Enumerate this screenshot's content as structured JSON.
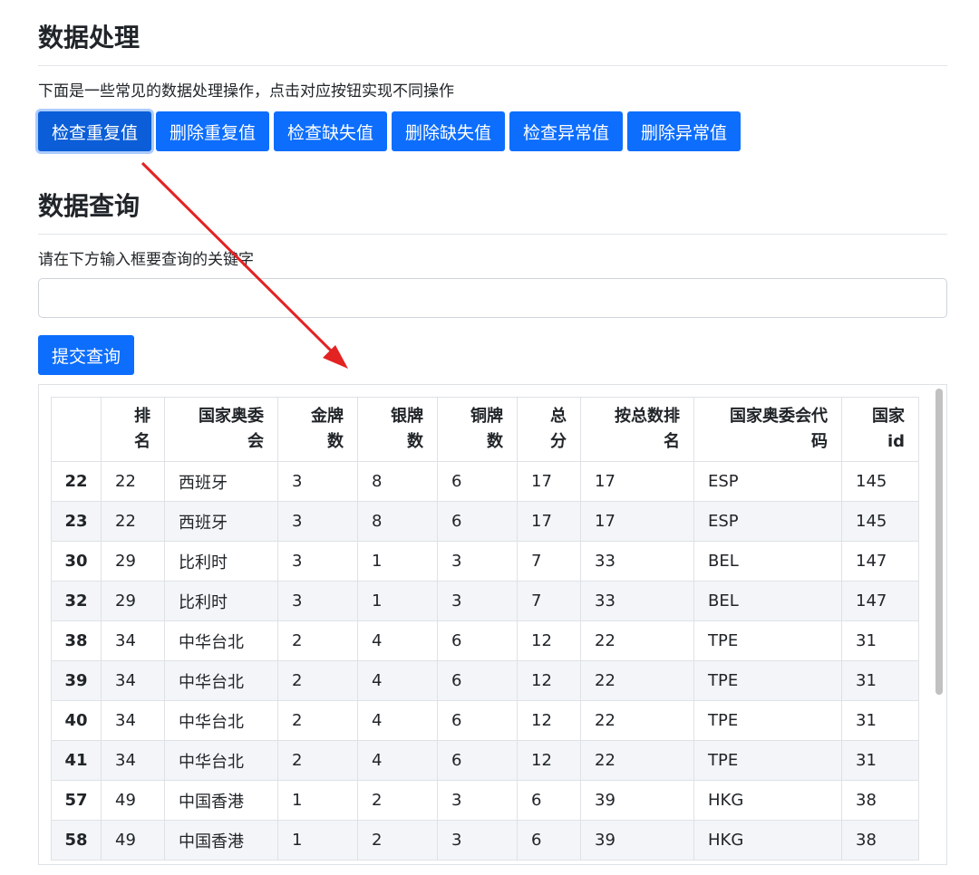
{
  "sections": {
    "processing": {
      "title": "数据处理",
      "description": "下面是一些常见的数据处理操作，点击对应按钮实现不同操作",
      "buttons": [
        "检查重复值",
        "删除重复值",
        "检查缺失值",
        "删除缺失值",
        "检查异常值",
        "删除异常值"
      ]
    },
    "query": {
      "title": "数据查询",
      "description": "请在下方输入框要查询的关键字",
      "input_value": "",
      "submit_label": "提交查询"
    }
  },
  "table": {
    "columns": [
      "",
      "排名",
      "国家奥委会",
      "金牌数",
      "银牌数",
      "铜牌数",
      "总分",
      "按总数排名",
      "国家奥委会代码",
      "国家id"
    ],
    "header_lines": [
      [
        ""
      ],
      [
        "排",
        "名"
      ],
      [
        "国家奥委",
        "会"
      ],
      [
        "金牌",
        "数"
      ],
      [
        "银牌",
        "数"
      ],
      [
        "铜牌",
        "数"
      ],
      [
        "总",
        "分"
      ],
      [
        "按总数排",
        "名"
      ],
      [
        "国家奥委会代",
        "码"
      ],
      [
        "国家",
        "id"
      ]
    ],
    "rows": [
      [
        "22",
        "22",
        "西班牙",
        "3",
        "8",
        "6",
        "17",
        "17",
        "ESP",
        "145"
      ],
      [
        "23",
        "22",
        "西班牙",
        "3",
        "8",
        "6",
        "17",
        "17",
        "ESP",
        "145"
      ],
      [
        "30",
        "29",
        "比利时",
        "3",
        "1",
        "3",
        "7",
        "33",
        "BEL",
        "147"
      ],
      [
        "32",
        "29",
        "比利时",
        "3",
        "1",
        "3",
        "7",
        "33",
        "BEL",
        "147"
      ],
      [
        "38",
        "34",
        "中华台北",
        "2",
        "4",
        "6",
        "12",
        "22",
        "TPE",
        "31"
      ],
      [
        "39",
        "34",
        "中华台北",
        "2",
        "4",
        "6",
        "12",
        "22",
        "TPE",
        "31"
      ],
      [
        "40",
        "34",
        "中华台北",
        "2",
        "4",
        "6",
        "12",
        "22",
        "TPE",
        "31"
      ],
      [
        "41",
        "34",
        "中华台北",
        "2",
        "4",
        "6",
        "12",
        "22",
        "TPE",
        "31"
      ],
      [
        "57",
        "49",
        "中国香港",
        "1",
        "2",
        "3",
        "6",
        "39",
        "HKG",
        "38"
      ],
      [
        "58",
        "49",
        "中国香港",
        "1",
        "2",
        "3",
        "6",
        "39",
        "HKG",
        "38"
      ]
    ]
  },
  "colors": {
    "primary": "#0d6efd",
    "annotation_arrow": "#e32222"
  }
}
